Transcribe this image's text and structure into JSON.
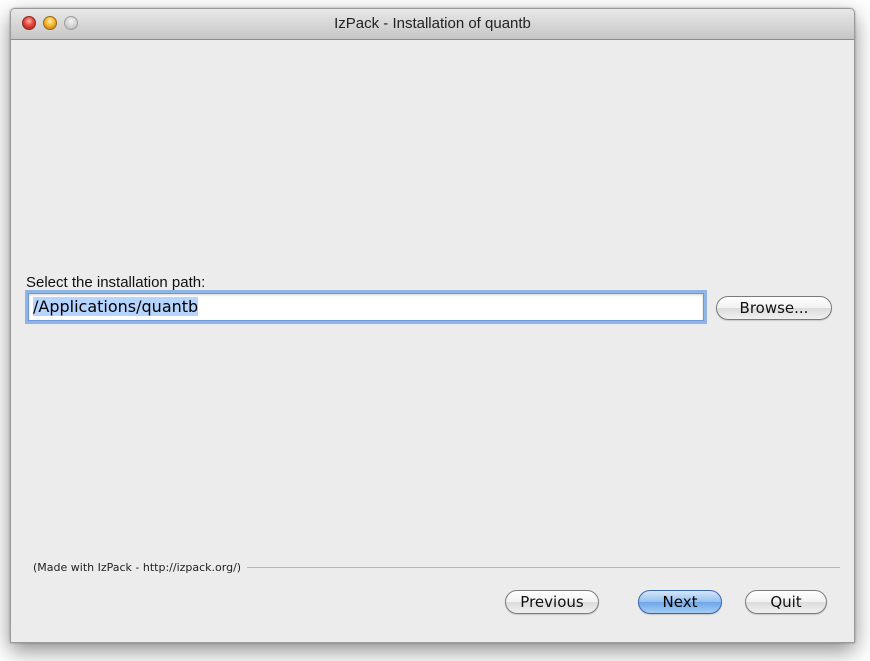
{
  "window": {
    "title": "IzPack - Installation of quantb"
  },
  "target_panel": {
    "label": "Select the installation path:",
    "path_value": "/Applications/quantb",
    "browse_label": "Browse..."
  },
  "footer": {
    "made_with": "(Made with IzPack - http://izpack.org/)"
  },
  "navigation": {
    "previous_label": "Previous",
    "next_label": "Next",
    "quit_label": "Quit"
  },
  "colors": {
    "window_bg": "#ececec",
    "focus_ring": "#8fb4e6",
    "default_button": "#6ea7e8",
    "close": "#e8463c",
    "minimize": "#f5b52e"
  },
  "icons": {
    "close": "close-traffic-light-icon",
    "minimize": "minimize-traffic-light-icon",
    "zoom": "zoom-traffic-light-icon"
  }
}
